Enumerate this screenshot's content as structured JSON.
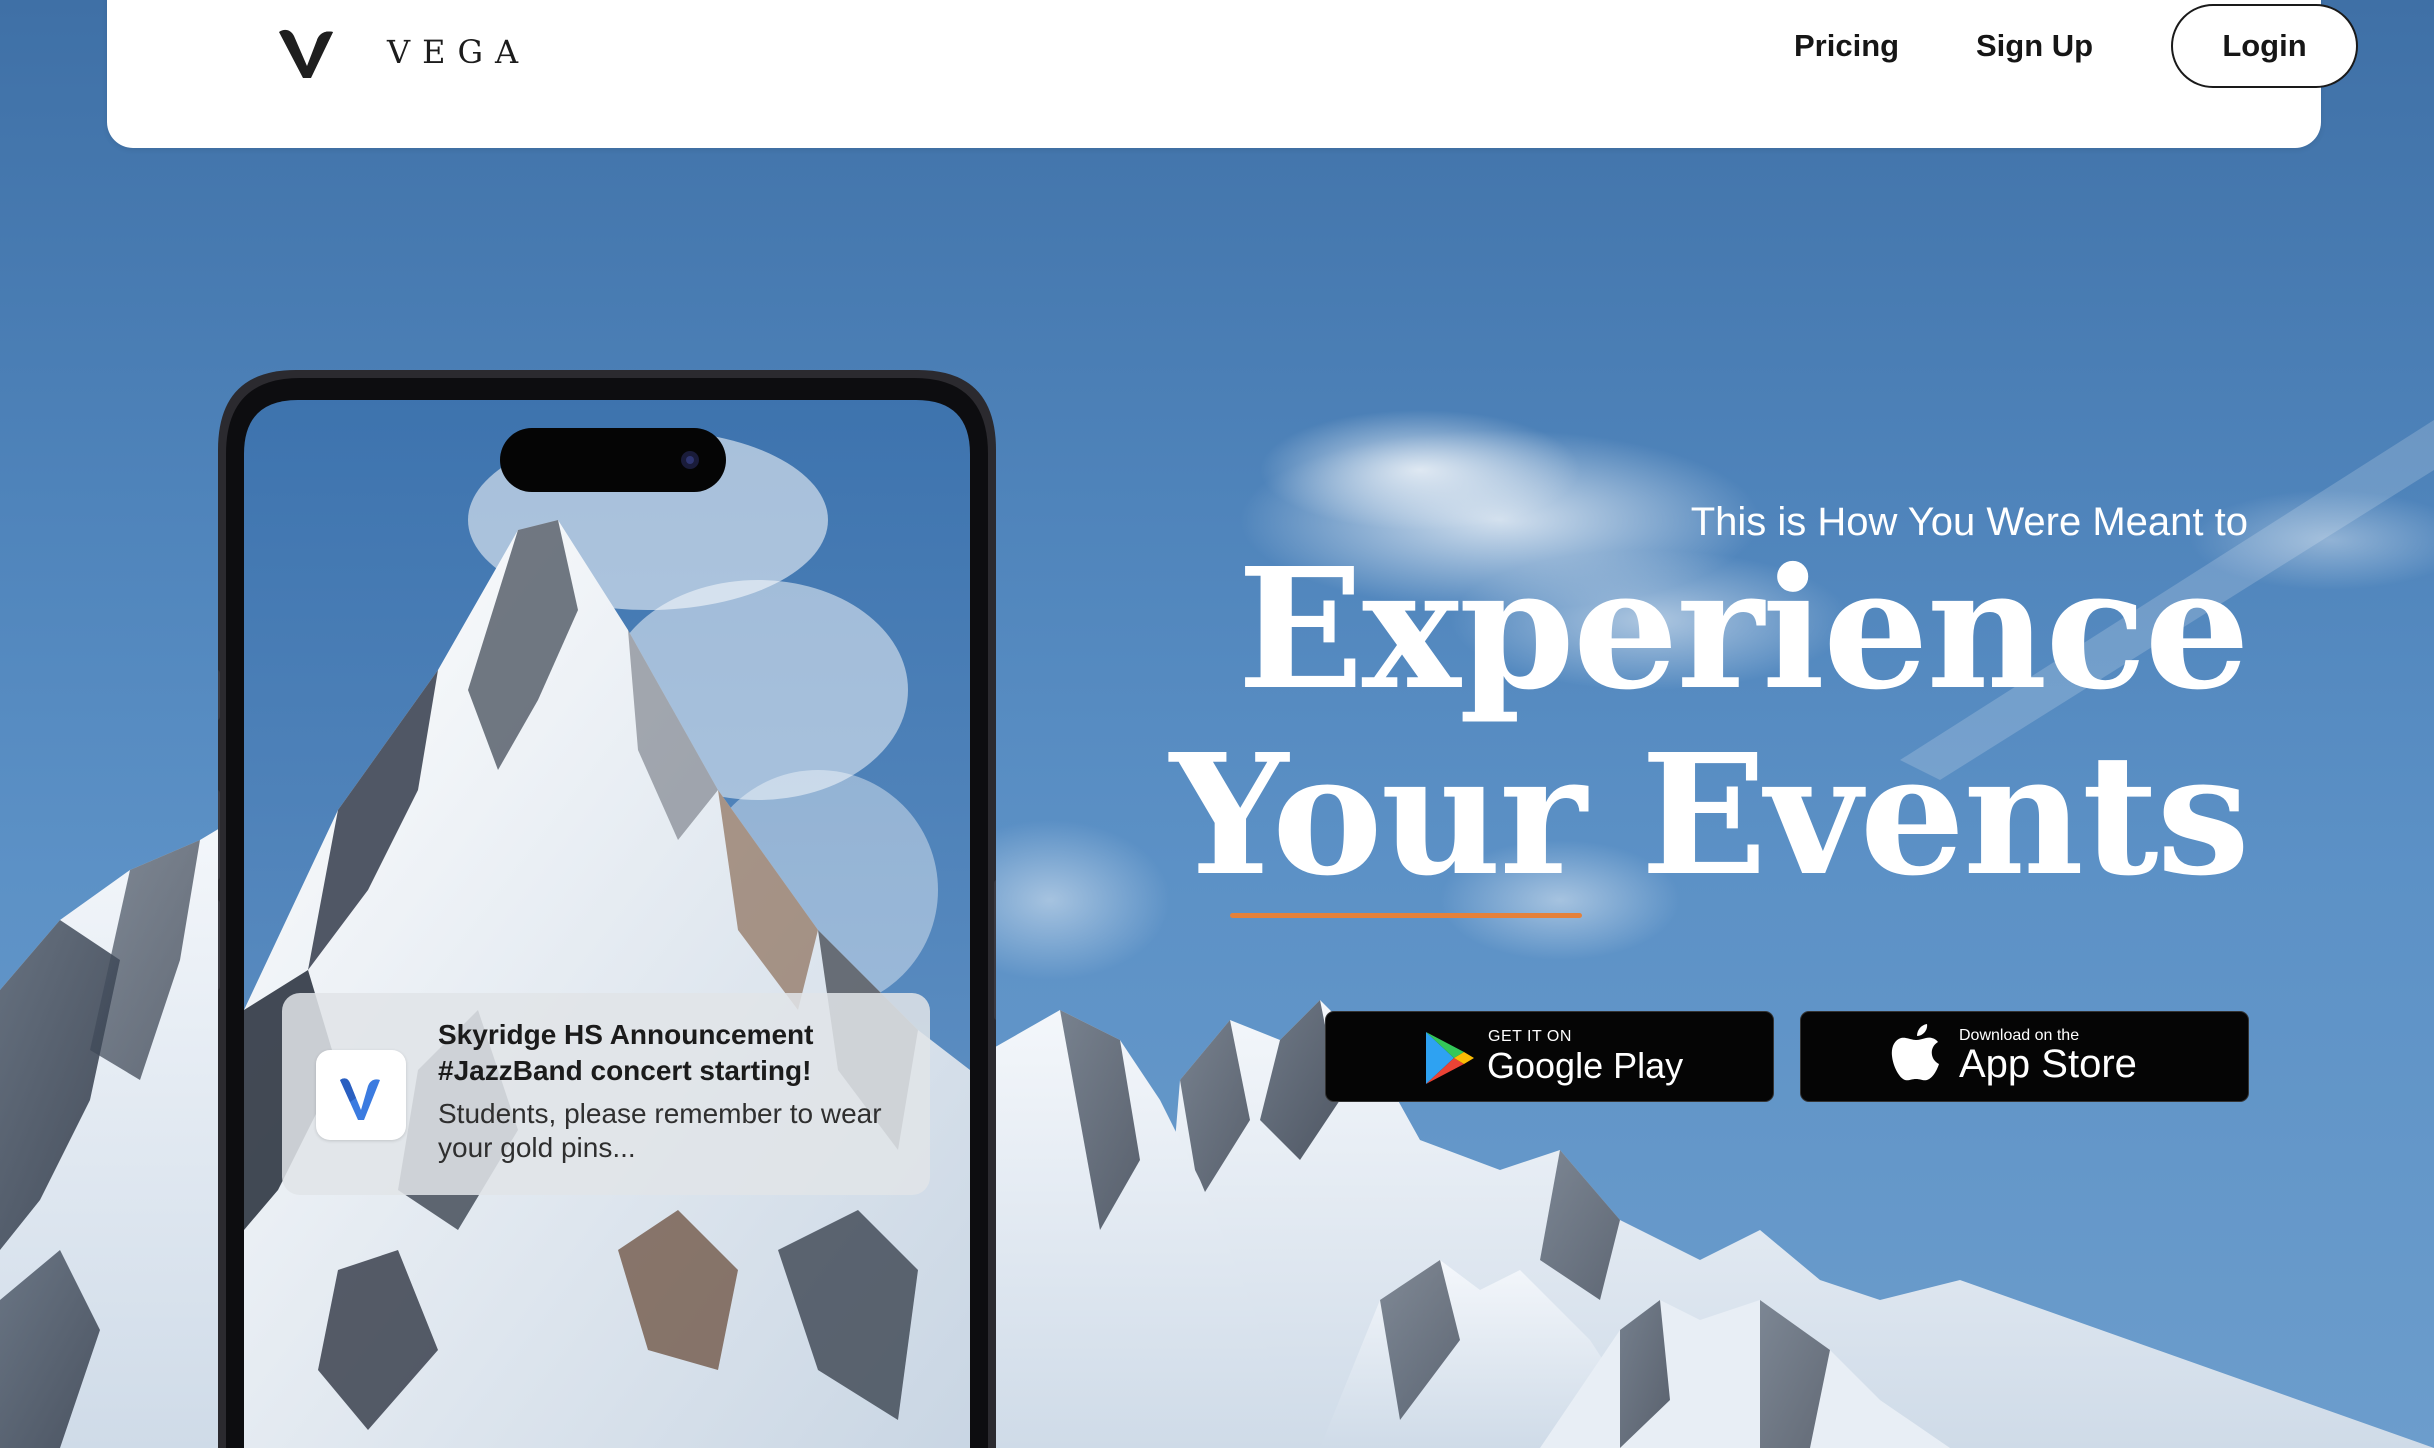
{
  "nav": {
    "brand": "VEGA",
    "logo_icon": "vega-v-logo-icon",
    "links": [
      {
        "label": "Pricing"
      },
      {
        "label": "Sign Up"
      }
    ],
    "login_label": "Login"
  },
  "hero": {
    "subtitle": "This is How You Were Meant to",
    "headline_line1": "Experience",
    "headline_line2": "Your Events",
    "accent_color": "#e5813a"
  },
  "stores": {
    "google": {
      "small": "GET IT ON",
      "big": "Google Play",
      "icon": "google-play-icon"
    },
    "apple": {
      "small": "Download on the",
      "big": "App Store",
      "icon": "apple-icon"
    }
  },
  "notification": {
    "title": "Skyridge HS Announcement",
    "subtitle": "#JazzBand concert starting!",
    "body": "Students, please remember to wear your gold pins...",
    "app_icon": "vega-app-icon"
  },
  "colors": {
    "sky": "#4f84bb",
    "navbar": "#ffffff",
    "store_button": "#050505"
  }
}
